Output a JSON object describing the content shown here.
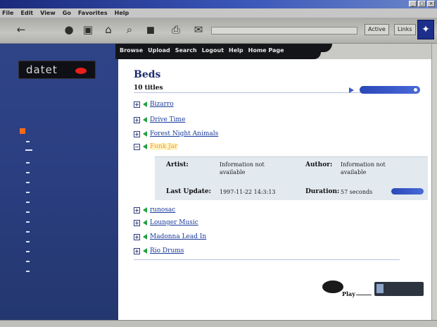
{
  "window": {
    "title": ""
  },
  "menu": {
    "items": [
      "File",
      "Edit",
      "View",
      "Go",
      "Favorites",
      "Help"
    ]
  },
  "toolbar": {
    "icons": [
      "back-icon",
      "stop-icon",
      "refresh-icon",
      "home-icon",
      "search-icon",
      "media-icon",
      "print-icon",
      "mail-icon"
    ],
    "buttons": [
      "Active",
      "Links"
    ]
  },
  "logo": {
    "text": "datet"
  },
  "topnav": {
    "links": [
      "Browse",
      "Upload",
      "Search",
      "Logout",
      "Help",
      "Home Page"
    ]
  },
  "main": {
    "title": "Beds",
    "count": "10 titles",
    "items": [
      "Bizarro",
      "Drive Time",
      "Forest Night Animals",
      "Funk Jar",
      "runosac",
      "Lounger Music",
      "Madonna Lead In",
      "Rio Drums"
    ],
    "selected_index": 3,
    "details": {
      "artist_label": "Artist:",
      "artist_value": "Information not available",
      "author_label": "Author:",
      "author_value": "Information not available",
      "updated_label": "Last Update:",
      "updated_value": "1997-11-22 14:3:13",
      "duration_label": "Duration:",
      "duration_value": "57 seconds"
    },
    "play_label": "Play"
  },
  "colors": {
    "accent": "#3a58c4",
    "sidebar": "#2a3e80",
    "selected": "#ff9a1a",
    "sound_icon": "#1fa040"
  }
}
